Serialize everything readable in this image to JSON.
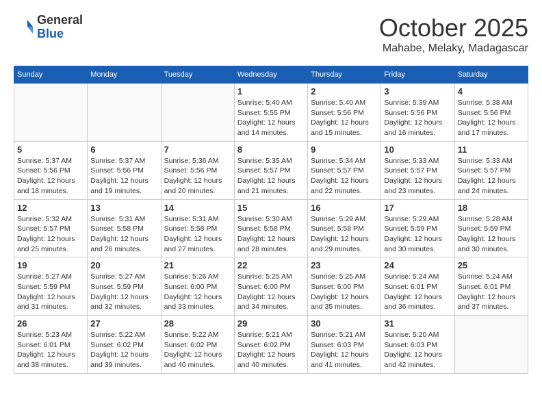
{
  "logo": {
    "general": "General",
    "blue": "Blue"
  },
  "title": "October 2025",
  "location": "Mahabe, Melaky, Madagascar",
  "days_of_week": [
    "Sunday",
    "Monday",
    "Tuesday",
    "Wednesday",
    "Thursday",
    "Friday",
    "Saturday"
  ],
  "weeks": [
    [
      {
        "day": "",
        "info": ""
      },
      {
        "day": "",
        "info": ""
      },
      {
        "day": "",
        "info": ""
      },
      {
        "day": "1",
        "info": "Sunrise: 5:40 AM\nSunset: 5:55 PM\nDaylight: 12 hours\nand 14 minutes."
      },
      {
        "day": "2",
        "info": "Sunrise: 5:40 AM\nSunset: 5:56 PM\nDaylight: 12 hours\nand 15 minutes."
      },
      {
        "day": "3",
        "info": "Sunrise: 5:39 AM\nSunset: 5:56 PM\nDaylight: 12 hours\nand 16 minutes."
      },
      {
        "day": "4",
        "info": "Sunrise: 5:38 AM\nSunset: 5:56 PM\nDaylight: 12 hours\nand 17 minutes."
      }
    ],
    [
      {
        "day": "5",
        "info": "Sunrise: 5:37 AM\nSunset: 5:56 PM\nDaylight: 12 hours\nand 18 minutes."
      },
      {
        "day": "6",
        "info": "Sunrise: 5:37 AM\nSunset: 5:56 PM\nDaylight: 12 hours\nand 19 minutes."
      },
      {
        "day": "7",
        "info": "Sunrise: 5:36 AM\nSunset: 5:56 PM\nDaylight: 12 hours\nand 20 minutes."
      },
      {
        "day": "8",
        "info": "Sunrise: 5:35 AM\nSunset: 5:57 PM\nDaylight: 12 hours\nand 21 minutes."
      },
      {
        "day": "9",
        "info": "Sunrise: 5:34 AM\nSunset: 5:57 PM\nDaylight: 12 hours\nand 22 minutes."
      },
      {
        "day": "10",
        "info": "Sunrise: 5:33 AM\nSunset: 5:57 PM\nDaylight: 12 hours\nand 23 minutes."
      },
      {
        "day": "11",
        "info": "Sunrise: 5:33 AM\nSunset: 5:57 PM\nDaylight: 12 hours\nand 24 minutes."
      }
    ],
    [
      {
        "day": "12",
        "info": "Sunrise: 5:32 AM\nSunset: 5:57 PM\nDaylight: 12 hours\nand 25 minutes."
      },
      {
        "day": "13",
        "info": "Sunrise: 5:31 AM\nSunset: 5:58 PM\nDaylight: 12 hours\nand 26 minutes."
      },
      {
        "day": "14",
        "info": "Sunrise: 5:31 AM\nSunset: 5:58 PM\nDaylight: 12 hours\nand 27 minutes."
      },
      {
        "day": "15",
        "info": "Sunrise: 5:30 AM\nSunset: 5:58 PM\nDaylight: 12 hours\nand 28 minutes."
      },
      {
        "day": "16",
        "info": "Sunrise: 5:29 AM\nSunset: 5:58 PM\nDaylight: 12 hours\nand 29 minutes."
      },
      {
        "day": "17",
        "info": "Sunrise: 5:29 AM\nSunset: 5:59 PM\nDaylight: 12 hours\nand 30 minutes."
      },
      {
        "day": "18",
        "info": "Sunrise: 5:28 AM\nSunset: 5:59 PM\nDaylight: 12 hours\nand 30 minutes."
      }
    ],
    [
      {
        "day": "19",
        "info": "Sunrise: 5:27 AM\nSunset: 5:59 PM\nDaylight: 12 hours\nand 31 minutes."
      },
      {
        "day": "20",
        "info": "Sunrise: 5:27 AM\nSunset: 5:59 PM\nDaylight: 12 hours\nand 32 minutes."
      },
      {
        "day": "21",
        "info": "Sunrise: 5:26 AM\nSunset: 6:00 PM\nDaylight: 12 hours\nand 33 minutes."
      },
      {
        "day": "22",
        "info": "Sunrise: 5:25 AM\nSunset: 6:00 PM\nDaylight: 12 hours\nand 34 minutes."
      },
      {
        "day": "23",
        "info": "Sunrise: 5:25 AM\nSunset: 6:00 PM\nDaylight: 12 hours\nand 35 minutes."
      },
      {
        "day": "24",
        "info": "Sunrise: 5:24 AM\nSunset: 6:01 PM\nDaylight: 12 hours\nand 36 minutes."
      },
      {
        "day": "25",
        "info": "Sunrise: 5:24 AM\nSunset: 6:01 PM\nDaylight: 12 hours\nand 37 minutes."
      }
    ],
    [
      {
        "day": "26",
        "info": "Sunrise: 5:23 AM\nSunset: 6:01 PM\nDaylight: 12 hours\nand 38 minutes."
      },
      {
        "day": "27",
        "info": "Sunrise: 5:22 AM\nSunset: 6:02 PM\nDaylight: 12 hours\nand 39 minutes."
      },
      {
        "day": "28",
        "info": "Sunrise: 5:22 AM\nSunset: 6:02 PM\nDaylight: 12 hours\nand 40 minutes."
      },
      {
        "day": "29",
        "info": "Sunrise: 5:21 AM\nSunset: 6:02 PM\nDaylight: 12 hours\nand 40 minutes."
      },
      {
        "day": "30",
        "info": "Sunrise: 5:21 AM\nSunset: 6:03 PM\nDaylight: 12 hours\nand 41 minutes."
      },
      {
        "day": "31",
        "info": "Sunrise: 5:20 AM\nSunset: 6:03 PM\nDaylight: 12 hours\nand 42 minutes."
      },
      {
        "day": "",
        "info": ""
      }
    ]
  ]
}
